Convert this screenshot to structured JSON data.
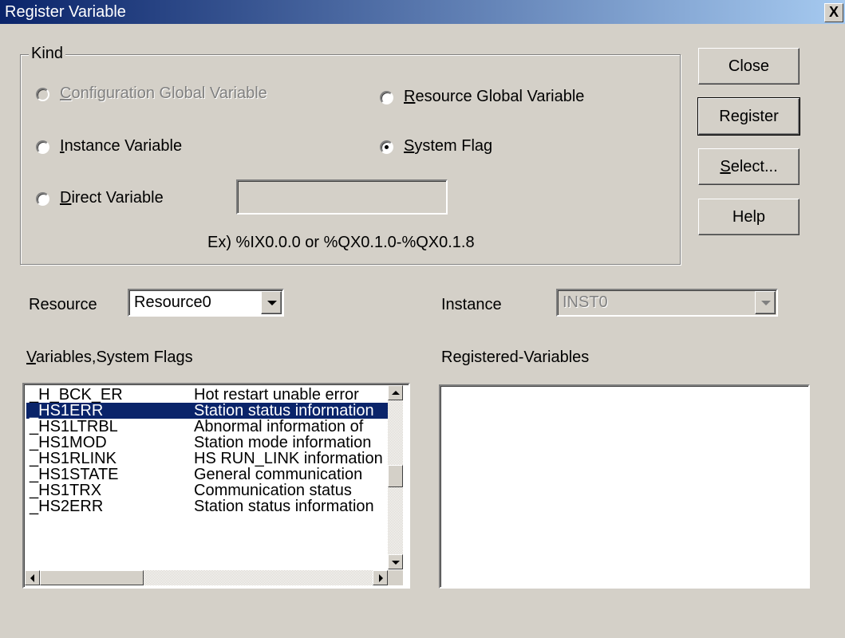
{
  "window": {
    "title": "Register Variable",
    "close_glyph": "X"
  },
  "kind": {
    "legend": "Kind",
    "options": [
      {
        "pre": "",
        "key": "C",
        "post": "onfiguration Global Variable",
        "selected": false,
        "disabled": true
      },
      {
        "pre": "",
        "key": "R",
        "post": "esource Global Variable",
        "selected": false,
        "disabled": false
      },
      {
        "pre": "",
        "key": "I",
        "post": "nstance Variable",
        "selected": false,
        "disabled": false
      },
      {
        "pre": "",
        "key": "S",
        "post": "ystem Flag",
        "selected": true,
        "disabled": false
      },
      {
        "pre": "",
        "key": "D",
        "post": "irect Variable",
        "selected": false,
        "disabled": false
      }
    ],
    "direct_value": "",
    "example": "Ex) %IX0.0.0 or %QX0.1.0-%QX0.1.8"
  },
  "buttons": [
    {
      "pre": "Close",
      "key": "",
      "post": ""
    },
    {
      "pre": "Re",
      "key": "g",
      "post": "ister"
    },
    {
      "pre": "",
      "key": "S",
      "post": "elect..."
    },
    {
      "pre": "Help",
      "key": "",
      "post": ""
    }
  ],
  "resource": {
    "label": "Resource",
    "value": "Resource0"
  },
  "instance": {
    "label": "Instance",
    "value": "INST0"
  },
  "variables_label": {
    "key": "V",
    "post": "ariables,System Flags"
  },
  "registered_label": "Registered-Variables",
  "variables": [
    {
      "name": "_H_BCK_ER",
      "desc": "Hot restart unable error",
      "selected": false
    },
    {
      "name": "_HS1ERR",
      "desc": "Station status information",
      "selected": true
    },
    {
      "name": "_HS1LTRBL",
      "desc": "Abnormal information of",
      "selected": false
    },
    {
      "name": "_HS1MOD",
      "desc": "Station mode information",
      "selected": false
    },
    {
      "name": "_HS1RLINK",
      "desc": "HS RUN_LINK information",
      "selected": false
    },
    {
      "name": "_HS1STATE",
      "desc": "General communication",
      "selected": false
    },
    {
      "name": "_HS1TRX",
      "desc": "Communication status",
      "selected": false
    },
    {
      "name": "_HS2ERR",
      "desc": "Station status information",
      "selected": false
    }
  ],
  "colors": {
    "titlebar_start": "#0a246a",
    "titlebar_end": "#a6caf0",
    "selection": "#0a246a",
    "face": "#d4d0c8"
  }
}
